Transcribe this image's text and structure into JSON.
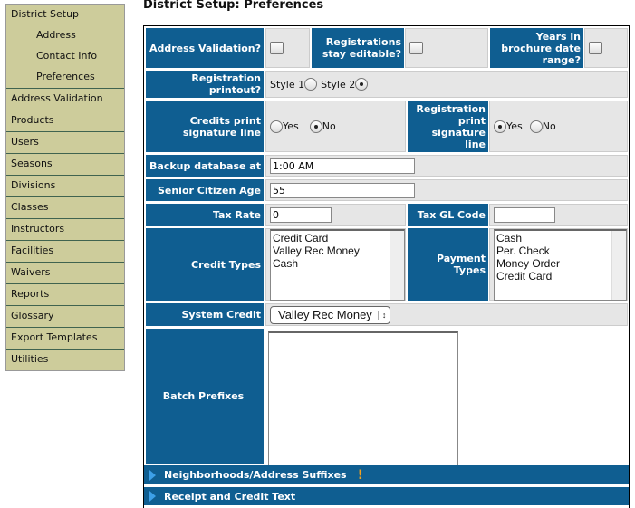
{
  "sidebar": {
    "items": [
      {
        "label": "District Setup"
      },
      {
        "label": "Address"
      },
      {
        "label": "Contact Info"
      },
      {
        "label": "Preferences"
      },
      {
        "label": "Address Validation"
      },
      {
        "label": "Products"
      },
      {
        "label": "Users"
      },
      {
        "label": "Seasons"
      },
      {
        "label": "Divisions"
      },
      {
        "label": "Classes"
      },
      {
        "label": "Instructors"
      },
      {
        "label": "Facilities"
      },
      {
        "label": "Waivers"
      },
      {
        "label": "Reports"
      },
      {
        "label": "Glossary"
      },
      {
        "label": "Export Templates"
      },
      {
        "label": "Utilities"
      }
    ]
  },
  "page": {
    "title": "District Setup: Preferences"
  },
  "form": {
    "address_validation": {
      "label": "Address Validation?",
      "checked": false
    },
    "registrations_editable": {
      "label": "Registrations stay editable?",
      "checked": false
    },
    "years_in_brochure": {
      "label": "Years in brochure date range?",
      "checked": false
    },
    "registration_printout": {
      "label": "Registration printout?",
      "option1": "Style 1",
      "option2": "Style 2",
      "selected": "Style 2"
    },
    "credits_signature": {
      "label": "Credits print signature line",
      "yes": "Yes",
      "no": "No",
      "selected": "No"
    },
    "registration_signature": {
      "label": "Registration print signature line",
      "yes": "Yes",
      "no": "No",
      "selected": "Yes"
    },
    "backup": {
      "label": "Backup database at",
      "value": "1:00 AM"
    },
    "senior_age": {
      "label": "Senior Citizen Age",
      "value": "55"
    },
    "tax_rate": {
      "label": "Tax Rate",
      "value": "0"
    },
    "tax_gl": {
      "label": "Tax GL Code",
      "value": ""
    },
    "credit_types": {
      "label": "Credit Types",
      "options": [
        "Credit Card",
        "Valley Rec Money",
        "Cash"
      ]
    },
    "payment_types": {
      "label": "Payment Types",
      "options": [
        "Cash",
        "Per. Check",
        "Money Order",
        "Credit Card"
      ]
    },
    "system_credit": {
      "label": "System Credit",
      "value": "Valley Rec Money"
    },
    "batch_prefixes": {
      "label": "Batch Prefixes",
      "value": ""
    }
  },
  "sections": [
    {
      "label": "Neighborhoods/Address Suffixes",
      "warning": "!"
    },
    {
      "label": "Receipt and Credit Text"
    }
  ],
  "colors": {
    "header_blue": "#0f5e91",
    "sidebar": "#cdcc9b",
    "warning": "#f0a020"
  }
}
